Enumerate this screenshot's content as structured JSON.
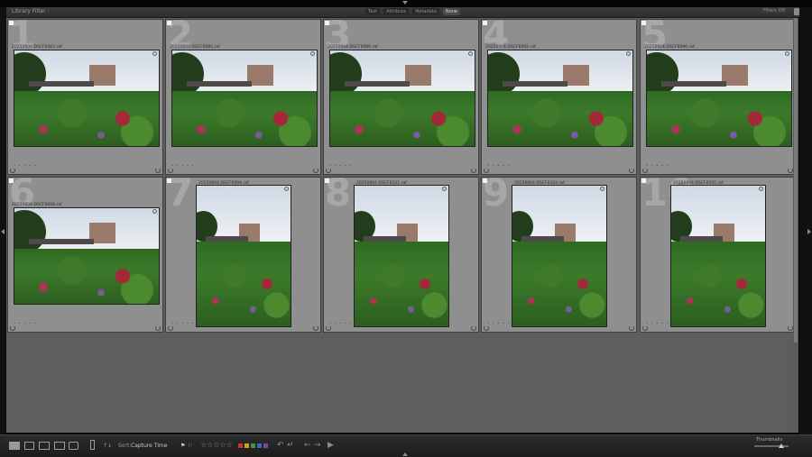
{
  "filter_bar": {
    "title": "Library Filter :",
    "options": [
      "Text",
      "Attribute",
      "Metadata",
      "None"
    ],
    "active": "None",
    "filters_off": "Filters Off"
  },
  "cells": [
    {
      "num": "1",
      "file": "20250604-DSCF6083.raf",
      "orientation": "landscape"
    },
    {
      "num": "2",
      "file": "20250604-DSCF6085.raf",
      "orientation": "landscape"
    },
    {
      "num": "3",
      "file": "20250604-DSCF6089.raf",
      "orientation": "landscape"
    },
    {
      "num": "4",
      "file": "20250604-DSCF6092.raf",
      "orientation": "landscape"
    },
    {
      "num": "5",
      "file": "20250604-DSCF6096.raf",
      "orientation": "landscape"
    },
    {
      "num": "6",
      "file": "20250604-DSCF6098.raf",
      "orientation": "landscape"
    },
    {
      "num": "7",
      "file": "20250604-DSCF6099.raf",
      "orientation": "portrait"
    },
    {
      "num": "8",
      "file": "20250604-DSCF6101.raf",
      "orientation": "portrait"
    },
    {
      "num": "9",
      "file": "20250604-DSCF6103.raf",
      "orientation": "portrait"
    },
    {
      "num": "10",
      "file": "20250604-DSCF6105.raf",
      "orientation": "portrait"
    }
  ],
  "toolbar": {
    "sort_label": "Sort:",
    "sort_value": "Capture Time",
    "stars": "☆☆☆☆☆",
    "color_labels": [
      "#c0392b",
      "#d4a017",
      "#3a9a3a",
      "#2f6fba",
      "#7d4aa0"
    ],
    "thumbnails_label": "Thumbnails",
    "thumbnail_size_fraction": 0.8
  },
  "icons": [
    "grid-view-icon",
    "loupe-view-icon",
    "compare-view-icon",
    "survey-view-icon",
    "people-view-icon",
    "spray-can-icon",
    "flag-icon",
    "rotate-left-icon",
    "rotate-right-icon",
    "previous-icon",
    "next-icon",
    "slideshow-play-icon"
  ]
}
